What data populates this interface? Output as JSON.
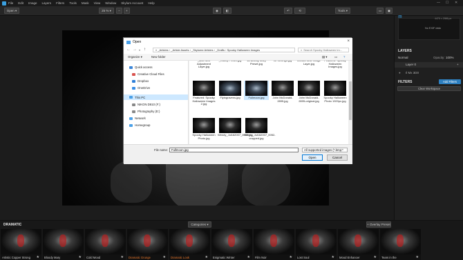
{
  "menubar": {
    "items": [
      "File",
      "Edit",
      "Image",
      "Layers",
      "Filters",
      "Tools",
      "Mask",
      "View",
      "Window",
      "Skylum Account",
      "Help"
    ]
  },
  "toolbar": {
    "open_label": "Open",
    "zoom_label": "25 %",
    "tools_label": "Tools"
  },
  "right_panel": {
    "histogram_text": "No EXIF data",
    "image_size": "4470 × 2986 px",
    "layers_title": "LAYERS",
    "blend_mode": "Normal",
    "opacity_label": "Opacity:",
    "opacity_value": "100%",
    "layer_name": "Layer 0",
    "layer_sub": "Il Mx 3D0",
    "filters_title": "FILTERS",
    "add_filters_label": "Add Filters",
    "clear_workspace_label": "Clear Workspace"
  },
  "presets": {
    "category": "DRAMATIC",
    "categories_label": "Categories",
    "overlay_label": "+ Overlay Preset",
    "items": [
      {
        "name": "Artistic Copper Strong",
        "active": false
      },
      {
        "name": "Bloody Mary",
        "active": false
      },
      {
        "name": "Cold Mood",
        "active": false
      },
      {
        "name": "Dramatic Grunge",
        "active": true
      },
      {
        "name": "Dramatic Look",
        "active": true
      },
      {
        "name": "Enigmatic Winter",
        "active": false
      },
      {
        "name": "Film Noir",
        "active": false
      },
      {
        "name": "Lost Soul",
        "active": false
      },
      {
        "name": "Mood Enhancer",
        "active": false
      },
      {
        "name": "Tears in the",
        "active": false
      }
    ]
  },
  "dialog": {
    "title": "Open",
    "close_icon": "×",
    "path": "« _Articles › _Article Assets › _Skylume Articles › _Drafts › Spooky Halloween Images",
    "search_placeholder": "Search Spooky Halloween Im...",
    "organize_label": "Organize ▾",
    "new_folder_label": "New folder",
    "nav_items": [
      {
        "label": "Quick access",
        "color": "#3b86d8"
      },
      {
        "label": "Creative Cloud Files",
        "color": "#d9534f"
      },
      {
        "label": "Dropbox",
        "color": "#2f7fd8"
      },
      {
        "label": "OneDrive",
        "color": "#3a8ee6"
      },
      {
        "label": "This PC",
        "color": "#4aa0e8"
      },
      {
        "label": "NIKON D810 (F:)",
        "color": "#888888"
      },
      {
        "label": "Photography (E:)",
        "color": "#888888"
      },
      {
        "label": "Network",
        "color": "#4aa0e8"
      },
      {
        "label": "Homegroup",
        "color": "#4aa0e8"
      }
    ],
    "files_row0": [
      {
        "name": "_add New Adjustment Layer.jpg"
      },
      {
        "name": "_Clarity Preset.jpg"
      },
      {
        "name": "1a Bloody Mary Preset.jpg"
      },
      {
        "name": "1b Settings.jpg"
      },
      {
        "name": "2a Add New Image Layer.jpg"
      },
      {
        "name": "Featured: Spooky Halloween Images.jpg"
      }
    ],
    "files_row1": [
      {
        "name": "Featured: Spooky Halloween Images 2.jpg"
      },
      {
        "name": "Flyingravens.jpg"
      },
      {
        "name": "Fullmoon.jpg"
      },
      {
        "name": "John McDonald-2895.jpg"
      },
      {
        "name": "John McDonald-2895-original.jpg"
      },
      {
        "name": "Spooky Halloween Photo 1920px.jpg"
      }
    ],
    "files_row2": [
      {
        "name": "Spooky Halloween Photo.jpg"
      },
      {
        "name": "Wendy_Jul162007_0052.jpg"
      },
      {
        "name": "Wendy_Jul162007_0052-cropped.jpg"
      }
    ],
    "file_name_label": "File name:",
    "file_name_value": "Fullmoon.jpg",
    "file_type_value": "All supported images (*.bmp;*",
    "open_label": "Open",
    "cancel_label": "Cancel"
  }
}
